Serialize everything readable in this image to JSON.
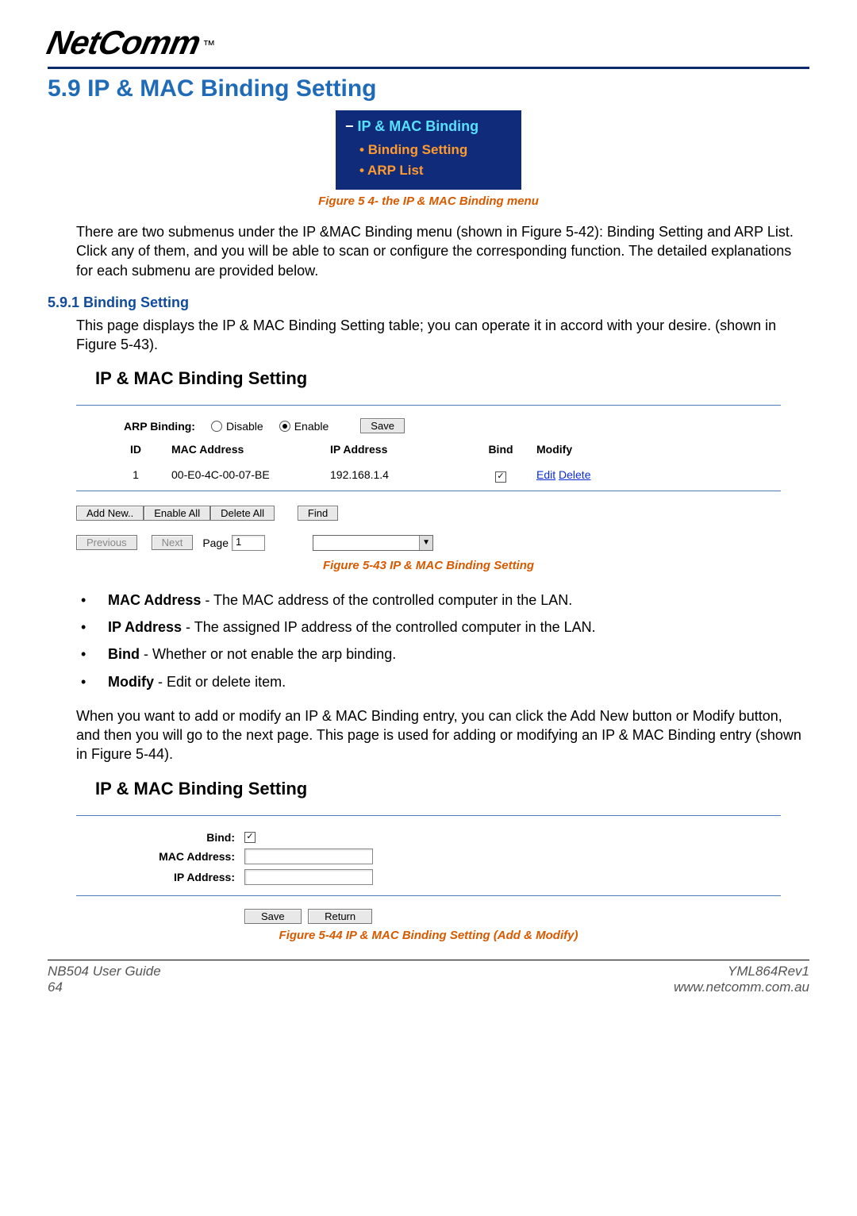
{
  "brand": {
    "name": "NetComm",
    "tm": "™"
  },
  "section": {
    "number": "5.9",
    "title": "IP & MAC Binding Setting"
  },
  "menu": {
    "root": "IP & MAC Binding",
    "items": [
      "Binding Setting",
      "ARP List"
    ]
  },
  "captions": {
    "fig54": "Figure 5 4- the IP & MAC Binding menu",
    "fig543": "Figure 5-43 IP & MAC Binding Setting",
    "fig544": "Figure 5-44 IP & MAC Binding Setting (Add & Modify)"
  },
  "para": {
    "intro": "There are two submenus under the IP &MAC Binding menu (shown in Figure 5-42): Binding Setting and ARP List. Click any of them, and you will be able to scan or configure the corresponding function. The detailed explanations for each submenu are provided below.",
    "sub_title": "5.9.1 Binding Setting",
    "sub_intro": "This page displays the IP & MAC Binding Setting table; you can operate it in accord with your desire. (shown in Figure 5-43).",
    "add_modify": "When you want to add or modify an IP & MAC Binding entry, you can click the Add New button or Modify button, and then you will go to the next page. This page is used for adding or modifying an IP & MAC Binding entry (shown in Figure 5-44)."
  },
  "panel1": {
    "title": "IP & MAC Binding Setting",
    "arp_label": "ARP Binding:",
    "disable": "Disable",
    "enable": "Enable",
    "save": "Save",
    "columns": {
      "id": "ID",
      "mac": "MAC Address",
      "ip": "IP Address",
      "bind": "Bind",
      "modify": "Modify"
    },
    "rows": [
      {
        "id": "1",
        "mac": "00-E0-4C-00-07-BE",
        "ip": "192.168.1.4",
        "bind": true,
        "edit": "Edit",
        "delete": "Delete"
      }
    ],
    "buttons": {
      "add": "Add New..",
      "enable_all": "Enable All",
      "delete_all": "Delete All",
      "find": "Find"
    },
    "pager": {
      "prev": "Previous",
      "next": "Next",
      "page_label": "Page",
      "page_value": "1"
    }
  },
  "bullets": [
    {
      "term": "MAC Address",
      "text": " - The MAC address of the controlled computer in the LAN."
    },
    {
      "term": "IP Address",
      "text": " - The assigned IP address of the controlled computer in the LAN."
    },
    {
      "term": "Bind",
      "text": " - Whether or not enable the arp binding."
    },
    {
      "term": "Modify",
      "text": " - Edit or delete item."
    }
  ],
  "panel2": {
    "title": "IP & MAC Binding Setting",
    "bind_label": "Bind:",
    "mac_label": "MAC Address:",
    "ip_label": "IP Address:",
    "save": "Save",
    "return": "Return"
  },
  "footer": {
    "left_top": "NB504 User Guide",
    "left_bottom": "64",
    "right_top": "YML864Rev1",
    "right_bottom": "www.netcomm.com.au"
  }
}
